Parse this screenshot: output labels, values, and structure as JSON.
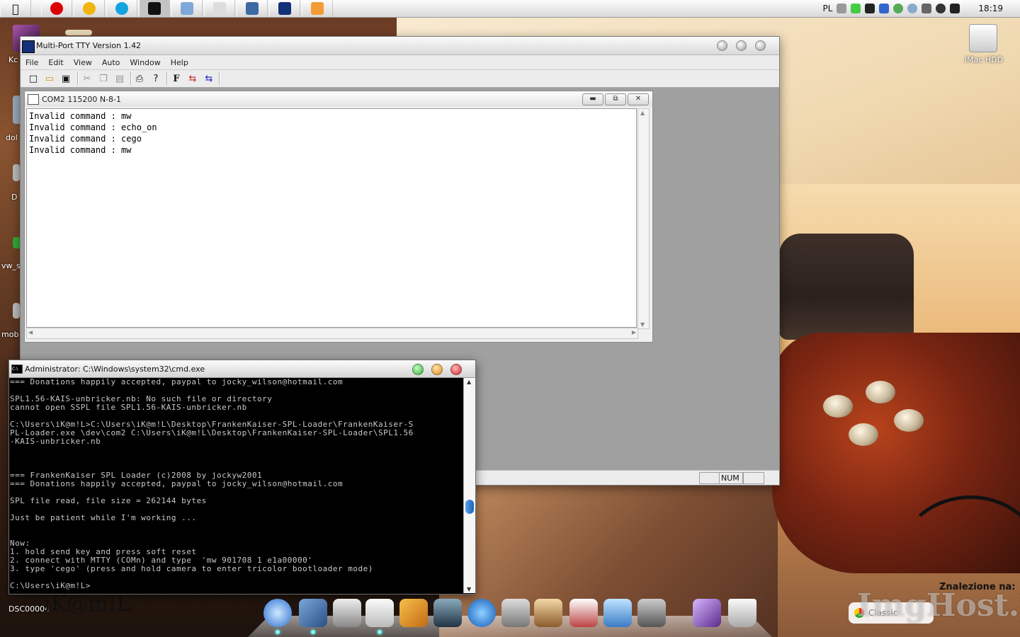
{
  "menubar": {
    "apps": [
      "opera",
      "clipboard",
      "skype",
      "cmd",
      "folder",
      "pen-tool",
      "window-manager",
      "mtty",
      "adobe"
    ],
    "language": "PL",
    "clock": "18:19"
  },
  "desktop": {
    "left_labels": [
      "Kc",
      "dol",
      "D",
      "vw_s",
      "mob",
      "DSC00004"
    ],
    "hdd_label": "iMac HDD",
    "signature": "iK@m!L",
    "found_label": "Znalezione na:",
    "classic_label": "Classic",
    "watermark": "ImgHost.pl"
  },
  "tty": {
    "title": "Multi-Port TTY Version 1.42",
    "menu": [
      "File",
      "Edit",
      "View",
      "Auto",
      "Window",
      "Help"
    ],
    "child": {
      "title": "COM2 115200  N-8-1",
      "lines": [
        "Invalid command : mw",
        "Invalid command : echo_on",
        "Invalid command : cego",
        "Invalid command : mw"
      ]
    },
    "status": {
      "num": "NUM"
    }
  },
  "cmd": {
    "title": "Administrator: C:\\Windows\\system32\\cmd.exe",
    "output": "=== Donations happily accepted, paypal to jocky_wilson@hotmail.com\n\nSPL1.56-KAIS-unbricker.nb: No such file or directory\ncannot open SSPL file SPL1.56-KAIS-unbricker.nb\n\nC:\\Users\\iK@m!L>C:\\Users\\iK@m!L\\Desktop\\FrankenKaiser-SPL-Loader\\FrankenKaiser-S\nPL-Loader.exe \\dev\\com2 C:\\Users\\iK@m!L\\Desktop\\FrankenKaiser-SPL-Loader\\SPL1.56\n-KAIS-unbricker.nb\n\n\n\n=== FrankenKaiser SPL Loader (c)2008 by jockyw2001\n=== Donations happily accepted, paypal to jocky_wilson@hotmail.com\n\nSPL file read, file size = 262144 bytes\n\nJust be patient while I'm working ...\n\n\nNow:\n1. hold send key and press soft reset\n2. connect with MTTY (COMn) and type  'mw 901708 1 e1a00000'\n3. type 'cego' (press and hold camera to enter tricolor bootloader mode)\n\nC:\\Users\\iK@m!L>"
  },
  "dock": {
    "items": [
      "safari",
      "preview",
      "calculator",
      "textedit",
      "instruments",
      "imovie",
      "quicktime",
      "automator",
      "chess",
      "home",
      "display",
      "system-preferences",
      "photo-booth",
      "trash"
    ]
  }
}
